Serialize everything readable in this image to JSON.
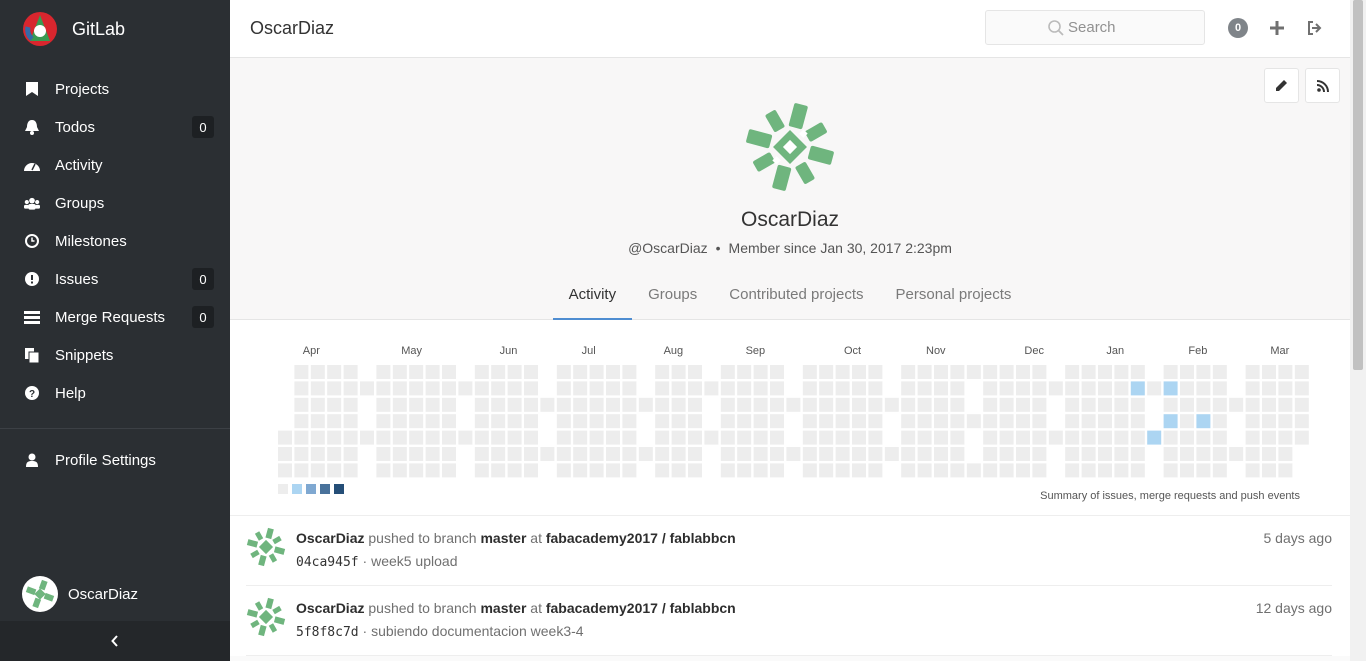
{
  "app": {
    "name": "GitLab"
  },
  "sidebar": {
    "items": [
      {
        "label": "Projects",
        "icon": "bookmark-icon"
      },
      {
        "label": "Todos",
        "icon": "bell-icon",
        "badge": "0"
      },
      {
        "label": "Activity",
        "icon": "dashboard-icon"
      },
      {
        "label": "Groups",
        "icon": "users-icon"
      },
      {
        "label": "Milestones",
        "icon": "clock-icon"
      },
      {
        "label": "Issues",
        "icon": "exclamation-circle-icon",
        "badge": "0"
      },
      {
        "label": "Merge Requests",
        "icon": "list-icon",
        "badge": "0"
      },
      {
        "label": "Snippets",
        "icon": "clipboard-icon"
      },
      {
        "label": "Help",
        "icon": "question-circle-icon"
      }
    ],
    "profile_settings": "Profile Settings",
    "user_name": "OscarDiaz"
  },
  "header": {
    "title": "OscarDiaz",
    "search_placeholder": "Search",
    "todo_count": "0"
  },
  "profile": {
    "name": "OscarDiaz",
    "handle": "@OscarDiaz",
    "separator": "•",
    "member_since": "Member since Jan 30, 2017 2:23pm"
  },
  "tabs": [
    "Activity",
    "Groups",
    "Contributed projects",
    "Personal projects"
  ],
  "calendar": {
    "months": [
      "Apr",
      "May",
      "Jun",
      "Jul",
      "Aug",
      "Sep",
      "Oct",
      "Nov",
      "Dec",
      "Jan",
      "Feb",
      "Mar"
    ],
    "summary": "Summary of issues, merge requests and push events",
    "colors": {
      "empty": "#ededed",
      "level1": "#acd5f2",
      "level2": "#7fa8d1",
      "level3": "#49729b",
      "level4": "#254e77"
    }
  },
  "events": [
    {
      "author": "OscarDiaz",
      "action": "pushed to branch",
      "branch": "master",
      "at": "at",
      "project": "fabacademy2017 / fablabbcn",
      "sha": "04ca945f",
      "sep": "·",
      "message": "week5 upload",
      "time": "5 days ago"
    },
    {
      "author": "OscarDiaz",
      "action": "pushed to branch",
      "branch": "master",
      "at": "at",
      "project": "fabacademy2017 / fablabbcn",
      "sha": "5f8f8c7d",
      "sep": "·",
      "message": "subiendo documentacion week3-4",
      "time": "12 days ago"
    }
  ]
}
